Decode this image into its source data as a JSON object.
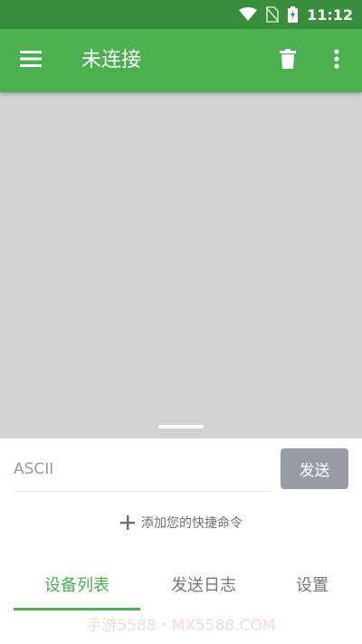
{
  "status_bar": {
    "time": "11:12",
    "icons": [
      "wifi-icon",
      "no-sim-icon",
      "battery-charging-icon"
    ]
  },
  "app_bar": {
    "title": "未连接",
    "menu_icon": "hamburger-menu-icon",
    "delete_icon": "trash-icon",
    "more_icon": "more-vert-icon"
  },
  "colors": {
    "status_bar": "#388e3c",
    "app_bar": "#4caf50",
    "content_bg": "#d3d3d3",
    "send_button": "#959ca5",
    "accent": "#4caf50"
  },
  "input": {
    "placeholder": "ASCII",
    "value": ""
  },
  "send_button": {
    "label": "发送"
  },
  "shortcut": {
    "label": "添加您的快捷命令",
    "icon": "plus-icon"
  },
  "tabs": [
    {
      "label": "设备列表",
      "active": true
    },
    {
      "label": "发送日志",
      "active": false
    },
    {
      "label": "设置",
      "active": false
    }
  ],
  "watermark": "手游5588・MX5588.COM"
}
